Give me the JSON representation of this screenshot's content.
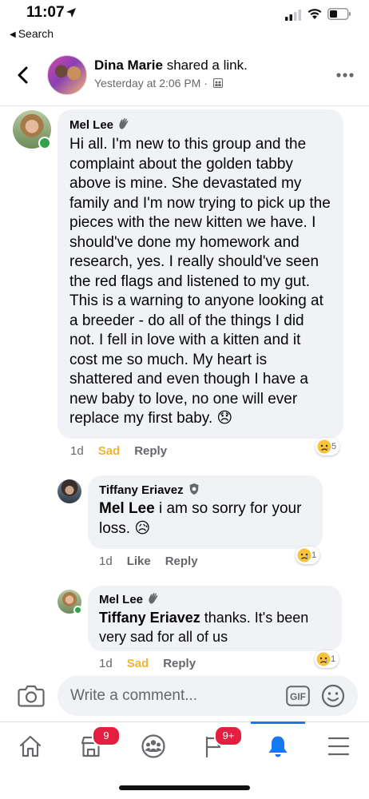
{
  "status_bar": {
    "time": "11:07",
    "back_app_label": "Search"
  },
  "post_header": {
    "author": "Dina Marie",
    "action": " shared a link.",
    "timestamp": "Yesterday at 2:06 PM · "
  },
  "comments": [
    {
      "author": "Mel Lee",
      "text": "Hi all. I'm new to this group and the complaint about the golden tabby above is mine. She devastated my family and I'm now trying to pick up the pieces with the new kitten we have. I should've done my homework and research, yes. I really should've seen the red flags and listened to my gut. This is a warning to anyone looking at a breeder - do all of the things I did not. I fell in love with a kitten and it cost me so much. My heart is shattered and even though I have a new baby to love, no one will ever replace my first baby. 😞",
      "age": "1d",
      "like_label": "Sad",
      "reply_label": "Reply",
      "reaction_count": "5"
    },
    {
      "author": "Tiffany Eriavez",
      "mention": "Mel Lee",
      "text": " i am so sorry for your loss. 😥",
      "age": "1d",
      "like_label": "Like",
      "reply_label": "Reply",
      "reaction_count": "1"
    },
    {
      "author": "Mel Lee",
      "mention": "Tiffany Eriavez",
      "text": " thanks. It's been very sad for all of us",
      "age": "1d",
      "like_label": "Sad",
      "reply_label": "Reply",
      "reaction_count": "1"
    }
  ],
  "composer": {
    "placeholder": "Write a comment...",
    "gif_label": "GIF"
  },
  "tabbar": {
    "items": [
      {
        "icon": "home-icon"
      },
      {
        "icon": "marketplace-icon",
        "badge": "9"
      },
      {
        "icon": "groups-icon"
      },
      {
        "icon": "pages-flag-icon",
        "badge": "9+"
      },
      {
        "icon": "notifications-bell-icon",
        "active": true
      },
      {
        "icon": "menu-icon"
      }
    ]
  },
  "colors": {
    "accent": "#1877f2",
    "sad_reaction": "#f0b433",
    "badge": "#e41e3f",
    "bubble": "#f0f2f5"
  }
}
